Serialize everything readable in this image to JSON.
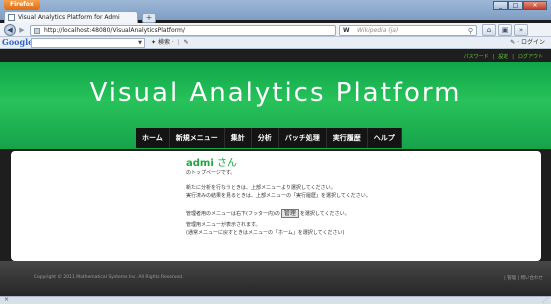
{
  "browser": {
    "app_button": "Firefox",
    "tab_title": "Visual Analytics Platform for Admi",
    "new_tab": "+",
    "url": "http://localhost:48080/VisualAnalyticsPlatform/",
    "search_engine": "W",
    "search_placeholder": "Wikipedia (ja)",
    "google_logo": "Google",
    "google_search_label": "検索",
    "login_label": "ログイン"
  },
  "page": {
    "util_links": [
      "パスワード",
      "設定",
      "ログアウト"
    ],
    "site_title": "Visual Analytics Platform",
    "menu": [
      "ホーム",
      "新規メニュー",
      "集計",
      "分析",
      "バッチ処理",
      "実行履歴",
      "ヘルプ"
    ],
    "greeting_name": "admi",
    "greeting_suffix": " さん",
    "lines": {
      "l1": "のトップページです。",
      "l2": "新たに分析を行なうときは、上部メニューより選択してください。",
      "l3": "実行済みの結果を見るときは、上部メニューの「実行履歴」を選択してください。",
      "l4_pre": "管理者用のメニューは右下(フッター内)の",
      "l4_btn": "管理",
      "l4_post": "を選択してください。",
      "l5": "管理用メニューが表示されます。",
      "l6": "(通常メニューに戻すときはメニューの「ホーム」を選択してください)"
    },
    "copyright": "Copyright © 2011 Mathematical Systems Inc. All Rights Reserved.",
    "footer_links": "| 管理 | 問い合わせ"
  }
}
